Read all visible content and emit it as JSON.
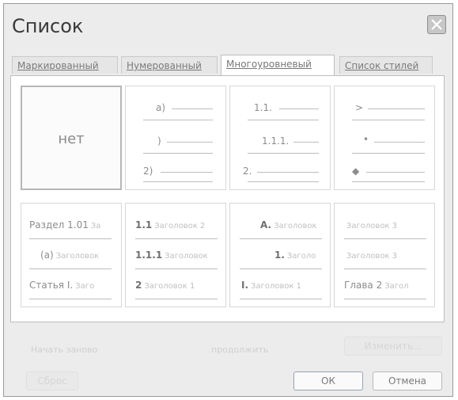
{
  "dialog": {
    "title": "Список",
    "close_label": "✕"
  },
  "tabs": [
    {
      "label": "Маркированный"
    },
    {
      "label": "Нумерованный"
    },
    {
      "label": "Многоуровневый"
    },
    {
      "label": "Список стилей"
    }
  ],
  "row1": {
    "none_label": "нет",
    "cell2": [
      "а)",
      ")",
      "2)"
    ],
    "cell3": [
      "1.1.",
      "1.1.1.",
      "2."
    ],
    "cell4": [
      ">",
      "•",
      "◆"
    ]
  },
  "row2": {
    "cell1": [
      {
        "main": "Раздел 1.01",
        "faint": "За"
      },
      {
        "main": "(а)",
        "faint": "Заголовок"
      },
      {
        "main": "Статья I.",
        "faint": "Заго"
      }
    ],
    "cell2": [
      {
        "main": "1.1",
        "faint": "Заголовок 2"
      },
      {
        "main": "1.1.1",
        "faint": "Заголовок"
      },
      {
        "main": "2",
        "faint": "Заголовок 1"
      }
    ],
    "cell3": [
      {
        "main": "A.",
        "faint": "Заголовок"
      },
      {
        "main": "1.",
        "faint": "Заголо"
      },
      {
        "main": "I.",
        "faint": "Заголовок 1"
      }
    ],
    "cell4": [
      {
        "main": "",
        "faint": "Заголовок 3"
      },
      {
        "main": "",
        "faint": "Заголовок 3"
      },
      {
        "main": "Глава 2",
        "faint": "Загол"
      }
    ]
  },
  "footer": {
    "restart_label": "Начать заново",
    "continue_label": "продолжить",
    "change_label": "Изменить...",
    "reset_label": "Сброс",
    "ok_label": "ОК",
    "cancel_label": "Отмена"
  }
}
